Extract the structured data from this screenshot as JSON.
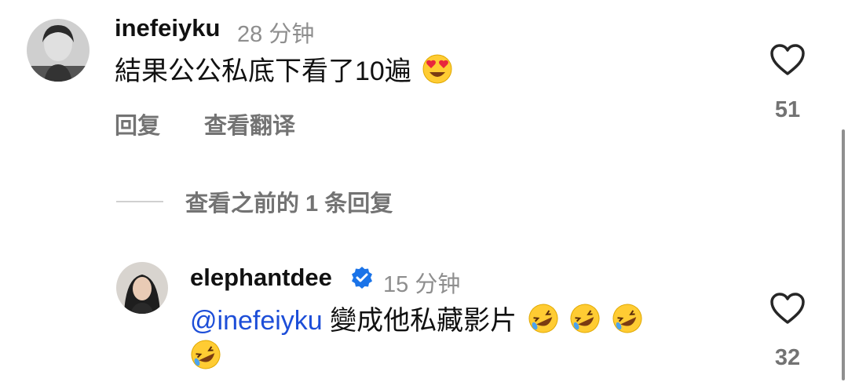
{
  "comments": [
    {
      "username": "inefeiyku",
      "time": "28 分钟",
      "text": "結果公公私底下看了10遍",
      "emoji": "heart-eyes-emoji",
      "reply_label": "回复",
      "translate_label": "查看翻译",
      "like_count": "51"
    },
    {
      "username": "elephantdee",
      "verified": true,
      "time": "15 分钟",
      "mention": "@inefeiyku",
      "text": "變成他私藏影片",
      "emoji": "rolling-laughing-emoji",
      "like_count": "32"
    }
  ],
  "view_replies_label": "查看之前的 1 条回复",
  "colors": {
    "mention": "#1d4ed8",
    "verified": "#1a73e8",
    "secondary": "#737373"
  }
}
